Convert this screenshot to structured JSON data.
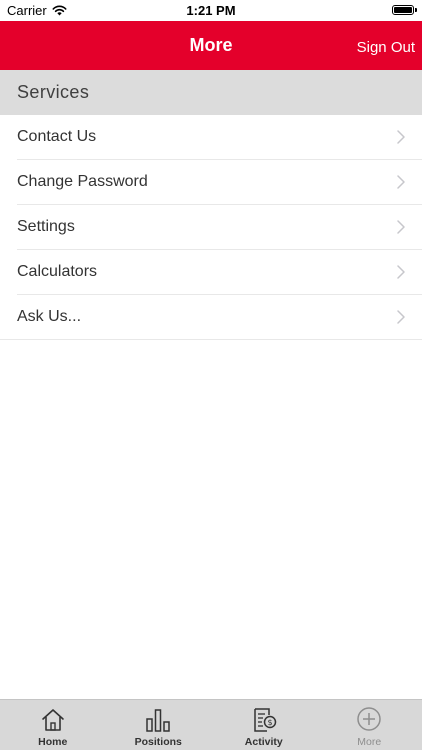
{
  "status_bar": {
    "carrier": "Carrier",
    "time": "1:21 PM"
  },
  "nav": {
    "title": "More",
    "right_action": "Sign Out"
  },
  "section": {
    "title": "Services"
  },
  "menu": {
    "items": [
      {
        "label": "Contact Us",
        "icon": "chevron-right-icon"
      },
      {
        "label": "Change Password",
        "icon": "chevron-right-icon"
      },
      {
        "label": "Settings",
        "icon": "chevron-right-icon"
      },
      {
        "label": "Calculators",
        "icon": "chevron-right-icon"
      },
      {
        "label": "Ask Us...",
        "icon": "chevron-right-icon"
      }
    ]
  },
  "tabs": [
    {
      "label": "Home",
      "icon": "home-icon"
    },
    {
      "label": "Positions",
      "icon": "bar-chart-icon"
    },
    {
      "label": "Activity",
      "icon": "document-dollar-icon"
    },
    {
      "label": "More",
      "icon": "plus-circle-icon",
      "selected": true
    }
  ],
  "colors": {
    "brand": "#e4002b",
    "section_bg": "#dcdcdc",
    "tab_bar_bg": "#d8d8d8"
  }
}
